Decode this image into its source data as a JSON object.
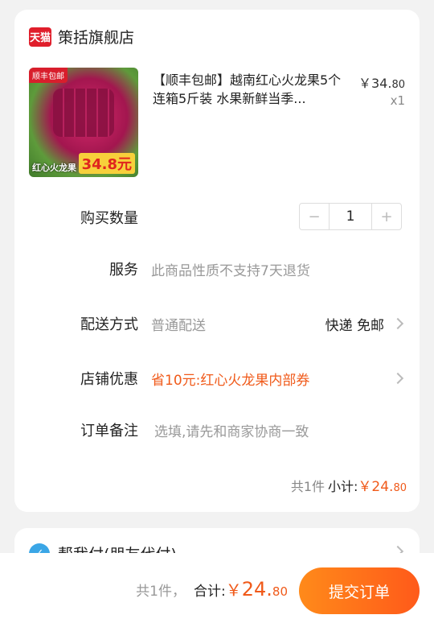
{
  "store": {
    "badge": "天猫",
    "name": "策括旗舰店"
  },
  "product": {
    "image_tag": "顺丰包邮",
    "image_name": "红心火龙果",
    "image_price": "34.8元",
    "title": "【顺丰包邮】越南红心火龙果5个连箱5斤装 水果新鲜当季...",
    "price_symbol": "￥",
    "price_main": "34.",
    "price_decimal": "80",
    "quantity_label": "x1"
  },
  "order": {
    "quantity": {
      "label": "购买数量",
      "value": "1",
      "minus": "−",
      "plus": "+"
    },
    "service": {
      "label": "服务",
      "value": "此商品性质不支持7天退货"
    },
    "delivery": {
      "label": "配送方式",
      "value": "普通配送",
      "right": "快递 免邮"
    },
    "coupon": {
      "label": "店铺优惠",
      "value": "省10元:红心火龙果内部券"
    },
    "note": {
      "label": "订单备注",
      "placeholder": "选填,请先和商家协商一致"
    },
    "subtotal": {
      "count": "共1件",
      "label": "小计:",
      "symbol": "￥",
      "main": "24.",
      "decimal": "80"
    }
  },
  "friend_pay": {
    "label": "帮我付(朋友代付)"
  },
  "footer": {
    "count": "共1件，",
    "label": "合计:",
    "symbol": "￥",
    "main": "24.",
    "decimal": "80",
    "submit": "提交订单"
  }
}
